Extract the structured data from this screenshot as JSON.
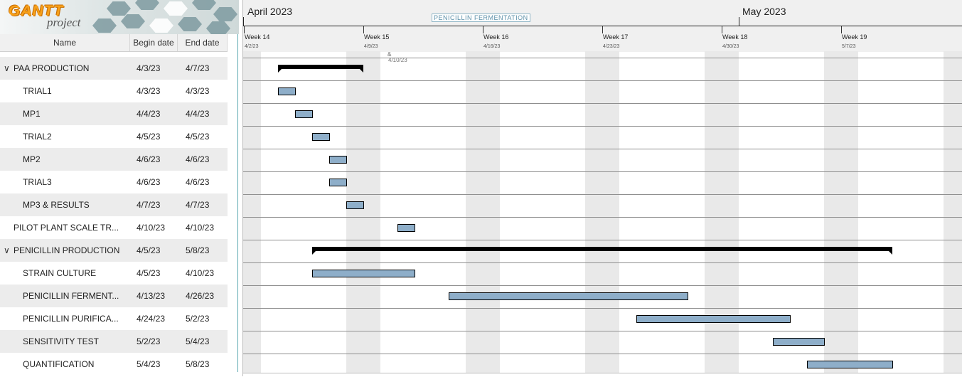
{
  "app": {
    "logo_text": "GANTT",
    "logo_sub": "project"
  },
  "table": {
    "headers": {
      "name": "Name",
      "begin": "Begin date",
      "end": "End date"
    },
    "rows": [
      {
        "name": "PAA PRODUCTION",
        "begin": "4/3/23",
        "end": "4/7/23",
        "level": 0,
        "expanded": true
      },
      {
        "name": "TRIAL1",
        "begin": "4/3/23",
        "end": "4/3/23",
        "level": 1
      },
      {
        "name": "MP1",
        "begin": "4/4/23",
        "end": "4/4/23",
        "level": 1
      },
      {
        "name": "TRIAL2",
        "begin": "4/5/23",
        "end": "4/5/23",
        "level": 1
      },
      {
        "name": "MP2",
        "begin": "4/6/23",
        "end": "4/6/23",
        "level": 1
      },
      {
        "name": "TRIAL3",
        "begin": "4/6/23",
        "end": "4/6/23",
        "level": 1
      },
      {
        "name": "MP3 & RESULTS",
        "begin": "4/7/23",
        "end": "4/7/23",
        "level": 1
      },
      {
        "name": "PILOT PLANT SCALE TR...",
        "begin": "4/10/23",
        "end": "4/10/23",
        "level": 0
      },
      {
        "name": "PENICILLIN PRODUCTION",
        "begin": "4/5/23",
        "end": "5/8/23",
        "level": 0,
        "expanded": true
      },
      {
        "name": "STRAIN CULTURE",
        "begin": "4/5/23",
        "end": "4/10/23",
        "level": 1
      },
      {
        "name": "PENICILLIN FERMENT...",
        "begin": "4/13/23",
        "end": "4/26/23",
        "level": 1
      },
      {
        "name": "PENICILLIN PURIFICA...",
        "begin": "4/24/23",
        "end": "5/2/23",
        "level": 1
      },
      {
        "name": "SENSITIVITY TEST",
        "begin": "5/2/23",
        "end": "5/4/23",
        "level": 1
      },
      {
        "name": "QUANTIFICATION",
        "begin": "5/4/23",
        "end": "5/8/23",
        "level": 1
      }
    ]
  },
  "timeline": {
    "months": [
      "April 2023",
      "May 2023"
    ],
    "weeks": [
      {
        "label": "Week 14",
        "date": "4/2/23"
      },
      {
        "label": "Week 15",
        "date": "4/9/23"
      },
      {
        "label": "Week 16",
        "date": "4/16/23"
      },
      {
        "label": "Week 17",
        "date": "4/23/23"
      },
      {
        "label": "Week 18",
        "date": "4/30/23"
      },
      {
        "label": "Week 19",
        "date": "5/7/23"
      }
    ],
    "phase_label": "PENICILLIN FERMENTATION",
    "today_marker": "&",
    "today_date": "4/10/23"
  },
  "colors": {
    "task_bar": "#8eaec9",
    "summary_bar": "#000000",
    "weekend": "#e9e9e9",
    "splitter": "#5aa7b0"
  }
}
